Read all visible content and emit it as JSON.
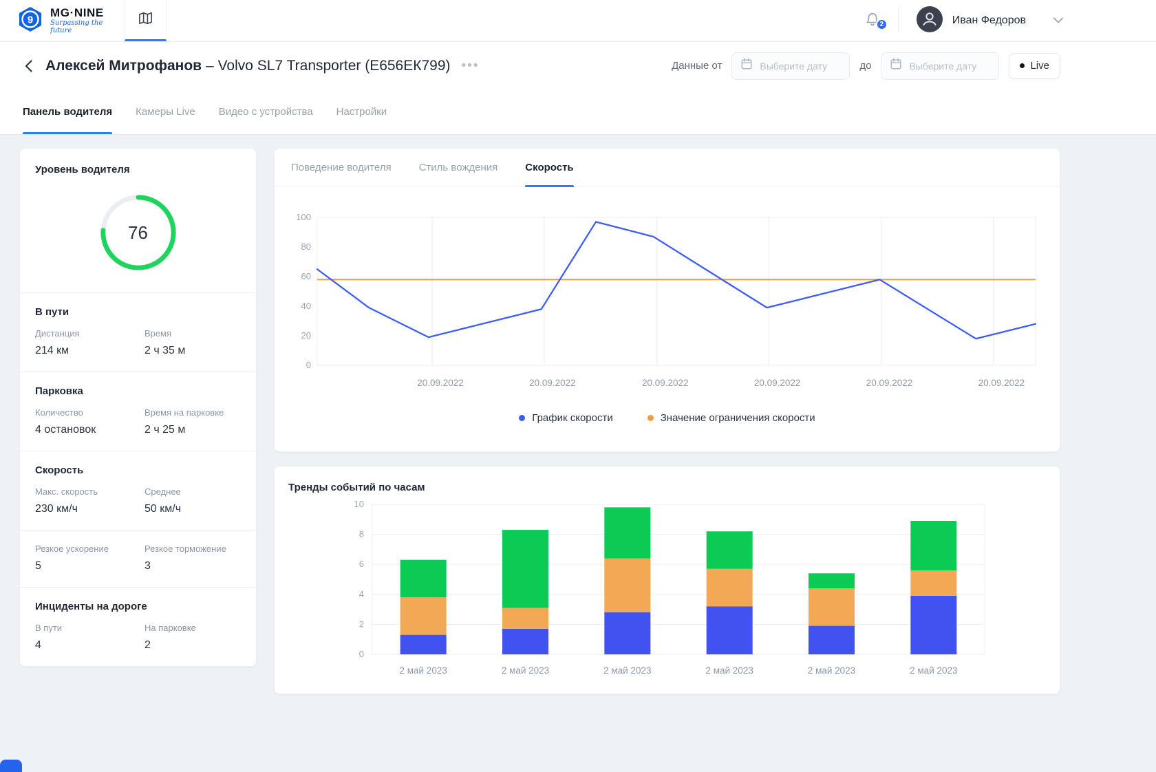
{
  "navbar": {
    "brand_name": "MG·NINE",
    "brand_tagline": "Surpassing the future",
    "notification_badge": "2",
    "user_name": "Иван Федоров"
  },
  "header": {
    "driver_name": "Алексей Митрофанов",
    "vehicle": "– Volvo SL7 Transporter (Е656ЕК799)",
    "data_from": "Данные от",
    "to": "до",
    "date_placeholder": "Выберите дату",
    "live": "Live"
  },
  "main_tabs": [
    {
      "label": "Панель водителя",
      "active": true
    },
    {
      "label": "Камеры Live",
      "active": false
    },
    {
      "label": "Видео с устройства",
      "active": false
    },
    {
      "label": "Настройки",
      "active": false
    }
  ],
  "driver_panel": {
    "level_title": "Уровень водителя",
    "level_value": "76",
    "level_color": "#1fd45c",
    "sections": [
      {
        "title": "В пути",
        "items": [
          {
            "label": "Дистанция",
            "value": "214 км"
          },
          {
            "label": "Время",
            "value": "2 ч 35 м"
          }
        ]
      },
      {
        "title": "Парковка",
        "items": [
          {
            "label": "Количество",
            "value": "4 остановок"
          },
          {
            "label": "Время на парковке",
            "value": "2 ч 25 м"
          }
        ]
      },
      {
        "title": "Скорость",
        "items": [
          {
            "label": "Макс. скорость",
            "value": "230 км/ч"
          },
          {
            "label": "Среднее",
            "value": "50 км/ч"
          }
        ]
      },
      {
        "title": "",
        "items": [
          {
            "label": "Резкое ускорение",
            "value": "5"
          },
          {
            "label": "Резкое торможение",
            "value": "3"
          }
        ]
      },
      {
        "title": "Инциденты на дороге",
        "items": [
          {
            "label": "В пути",
            "value": "4"
          },
          {
            "label": "На парковке",
            "value": "2"
          }
        ]
      }
    ]
  },
  "chart_tabs": [
    {
      "label": "Поведение водителя",
      "active": false
    },
    {
      "label": "Стиль вождения",
      "active": false
    },
    {
      "label": "Скорость",
      "active": true
    }
  ],
  "chart_data": [
    {
      "type": "line",
      "title": "",
      "ylim": [
        0,
        100
      ],
      "yticks": [
        0,
        20,
        40,
        60,
        80,
        100
      ],
      "x_ticks": [
        0.16,
        0.316,
        0.473,
        0.629,
        0.785,
        0.941
      ],
      "x_tick_labels": [
        "20.09.2022",
        "20.09.2022",
        "20.09.2022",
        "20.09.2022",
        "20.09.2022",
        "20.09.2022"
      ],
      "grid": "vertical",
      "legend_position": "bottom",
      "series": [
        {
          "name": "График скорости",
          "type": "line",
          "color": "#3d5cf5",
          "x": [
            0,
            0.072,
            0.155,
            0.312,
            0.388,
            0.468,
            0.626,
            0.783,
            0.917,
            1
          ],
          "values": [
            65,
            39,
            19,
            38,
            97,
            87,
            39,
            58,
            18,
            28
          ]
        },
        {
          "name": "Значение ограничения скорости",
          "type": "hline",
          "color": "#f59b40",
          "value": 58
        }
      ]
    },
    {
      "type": "bar",
      "stacked": true,
      "title": "Тренды событий по часам",
      "ylim": [
        0,
        10
      ],
      "yticks": [
        0,
        2,
        4,
        6,
        8,
        10
      ],
      "grid": "horizontal",
      "categories": [
        "2 май 2023",
        "2 май 2023",
        "2 май 2023",
        "2 май 2023",
        "2 май 2023",
        "2 май 2023"
      ],
      "series": [
        {
          "color": "#4152f0",
          "values": [
            1.3,
            1.7,
            2.8,
            3.2,
            1.9,
            3.9
          ]
        },
        {
          "color": "#f2a854",
          "values": [
            2.5,
            1.4,
            3.6,
            2.5,
            2.5,
            1.7
          ]
        },
        {
          "color": "#0ccb55",
          "values": [
            2.5,
            5.2,
            3.4,
            2.5,
            1.0,
            3.3
          ]
        }
      ]
    }
  ]
}
